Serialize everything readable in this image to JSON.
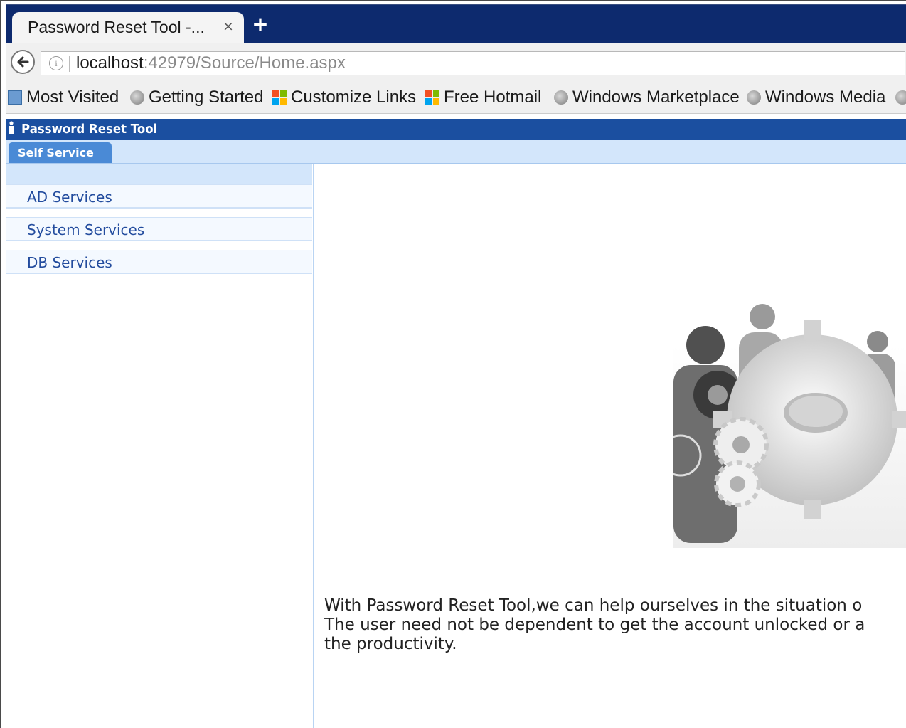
{
  "browser": {
    "tab_title": "Password Reset Tool -...",
    "tab_close": "×",
    "new_tab": "+",
    "url_host": "localhost",
    "url_rest": ":42979/Source/Home.aspx"
  },
  "bookmarks": [
    {
      "label": "Most Visited",
      "icon": "most-visited-icon"
    },
    {
      "label": "Getting Started",
      "icon": "globe-icon"
    },
    {
      "label": "Customize Links",
      "icon": "windows-logo-icon"
    },
    {
      "label": "Free Hotmail",
      "icon": "windows-logo-icon"
    },
    {
      "label": "Windows Marketplace",
      "icon": "globe-icon"
    },
    {
      "label": "Windows Media",
      "icon": "globe-icon"
    }
  ],
  "app": {
    "title": "Password Reset Tool",
    "tab": "Self Service"
  },
  "sidebar": {
    "items": [
      {
        "label": "AD Services"
      },
      {
        "label": "System Services"
      },
      {
        "label": "DB Services"
      }
    ]
  },
  "content": {
    "hero_image": "people-gears-illustration",
    "description_lines": [
      "With Password Reset Tool,we can help ourselves in the situation o",
      "The user need not be dependent to get the account unlocked or a",
      "the productivity."
    ]
  },
  "colors": {
    "tabstrip": "#0d2a6e",
    "app_header": "#1b4fa0",
    "accent_tab": "#4a8ad6",
    "sidebar_text": "#234c9e"
  }
}
